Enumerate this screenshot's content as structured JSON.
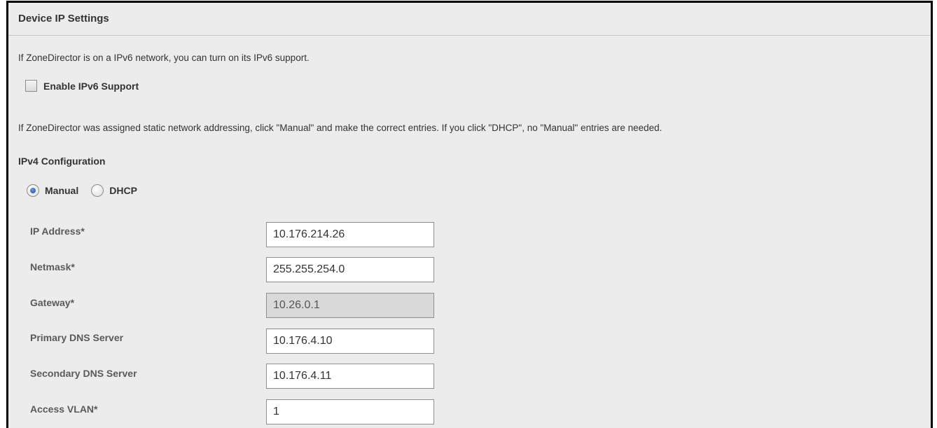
{
  "section": {
    "title": "Device IP Settings",
    "intro": "If ZoneDirector is on a IPv6 network, you can turn on its IPv6 support.",
    "ipv6_checkbox": {
      "label": "Enable IPv6 Support",
      "checked": false
    },
    "static_note": "If ZoneDirector was assigned static network addressing, click \"Manual\" and make the correct entries. If you click \"DHCP\", no \"Manual\" entries are needed."
  },
  "ipv4": {
    "title": "IPv4 Configuration",
    "mode_options": [
      {
        "label": "Manual",
        "selected": true
      },
      {
        "label": "DHCP",
        "selected": false
      }
    ],
    "fields": [
      {
        "label": "IP Address*",
        "value": "10.176.214.26",
        "disabled": false
      },
      {
        "label": "Netmask*",
        "value": "255.255.254.0",
        "disabled": false
      },
      {
        "label": "Gateway*",
        "value": "10.26.0.1",
        "disabled": true
      },
      {
        "label": "Primary DNS Server",
        "value": "10.176.4.10",
        "disabled": false
      },
      {
        "label": "Secondary DNS Server",
        "value": "10.176.4.11",
        "disabled": false
      },
      {
        "label": "Access VLAN*",
        "value": "1",
        "disabled": false
      }
    ]
  }
}
